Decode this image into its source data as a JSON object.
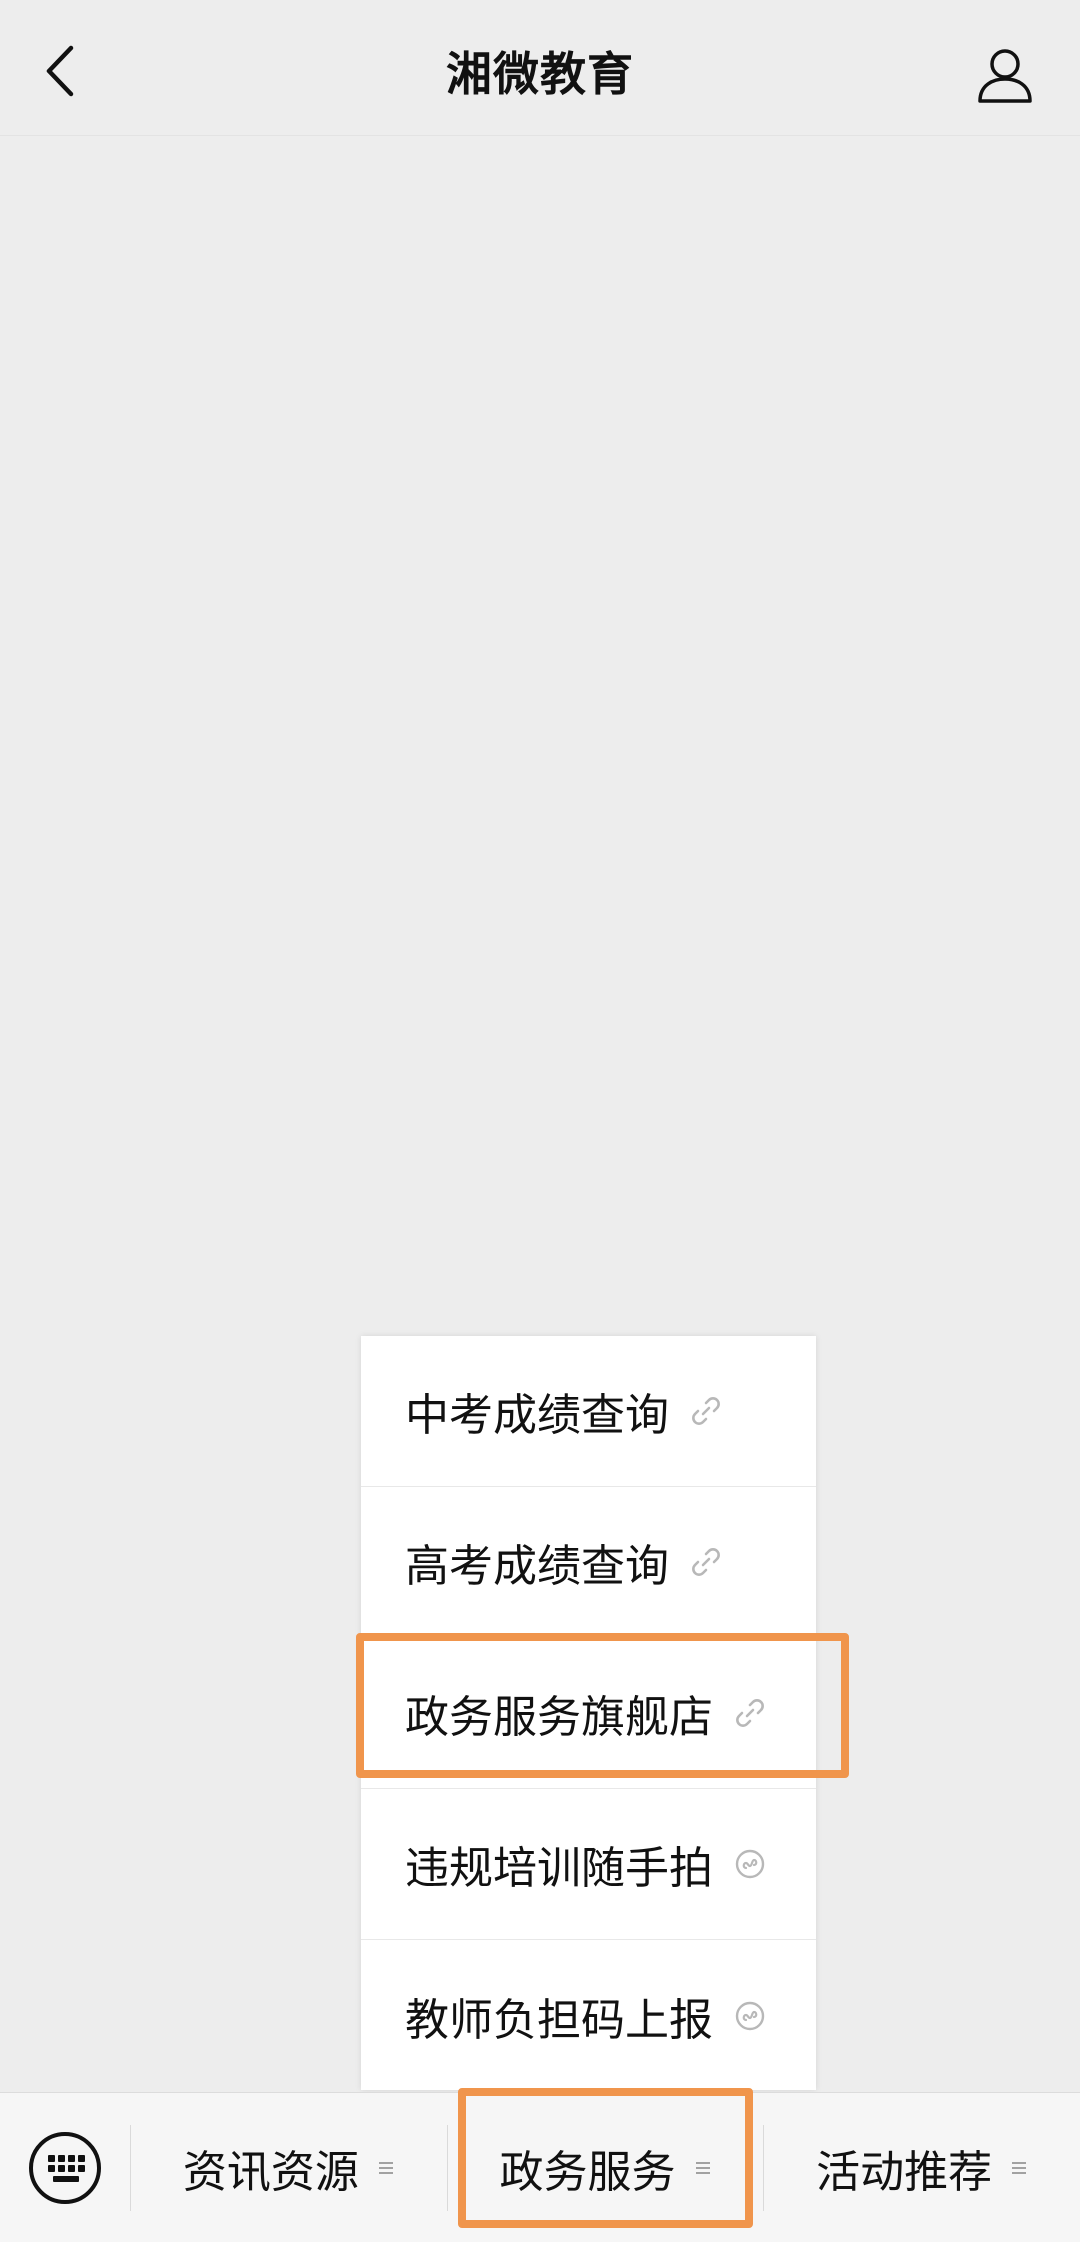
{
  "header": {
    "title": "湘微教育",
    "back_icon": "chevron-left-icon",
    "profile_icon": "user-icon"
  },
  "menu": {
    "items": [
      {
        "label": "中考成绩查询",
        "icon": "link-icon"
      },
      {
        "label": "高考成绩查询",
        "icon": "link-icon"
      },
      {
        "label": "政务服务旗舰店",
        "icon": "link-icon"
      },
      {
        "label": "违规培训随手拍",
        "icon": "mini-program-icon"
      },
      {
        "label": "教师负担码上报",
        "icon": "mini-program-icon"
      }
    ]
  },
  "bottom_bar": {
    "keyboard_icon": "keyboard-icon",
    "tabs": [
      {
        "label": "资讯资源"
      },
      {
        "label": "政务服务"
      },
      {
        "label": "活动推荐"
      }
    ]
  },
  "colors": {
    "background": "#ededed",
    "highlight": "#f0954c",
    "menu_bg": "#ffffff",
    "text": "#111111"
  }
}
